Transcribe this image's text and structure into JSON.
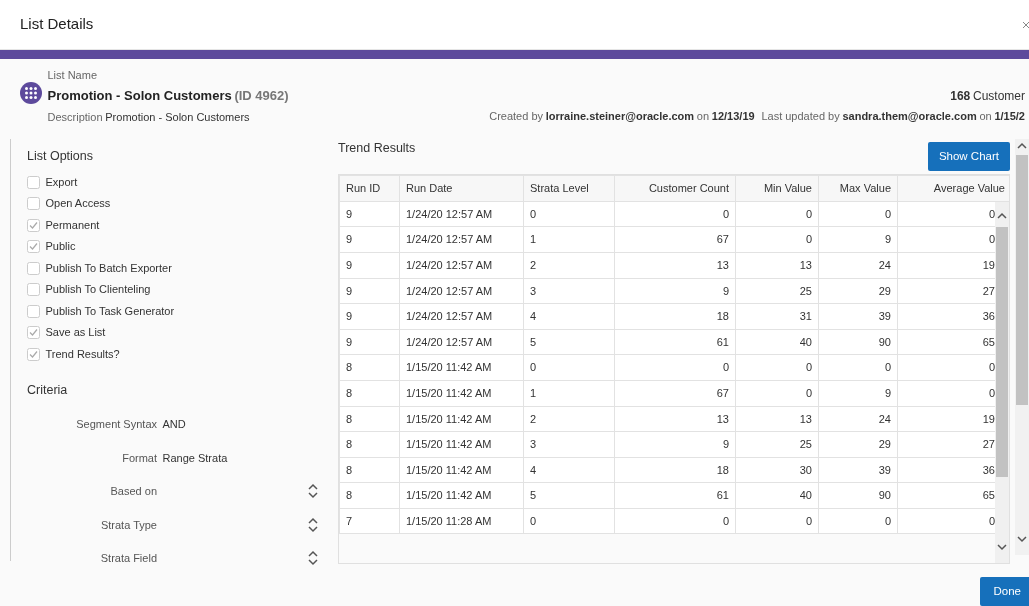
{
  "dialog": {
    "title": "List Details"
  },
  "list": {
    "name_label": "List Name",
    "name": "Promotion - Solon Customers",
    "id": "(ID 4962)",
    "description_label": "Description",
    "description": "Promotion - Solon Customers",
    "count": "168",
    "count_label": "Customer",
    "created_label": "Created by",
    "created_by": "lorraine.steiner@oracle.com",
    "created_on_label": "on",
    "created_on": "12/13/19",
    "updated_label": "Last updated by",
    "updated_by": "sandra.them@oracle.com",
    "updated_on_label": "on",
    "updated_on": "1/15/2"
  },
  "list_options": {
    "title": "List Options",
    "items": [
      {
        "label": "Export",
        "checked": false
      },
      {
        "label": "Open Access",
        "checked": false
      },
      {
        "label": "Permanent",
        "checked": true
      },
      {
        "label": "Public",
        "checked": true
      },
      {
        "label": "Publish To Batch Exporter",
        "checked": false
      },
      {
        "label": "Publish To Clienteling",
        "checked": false
      },
      {
        "label": "Publish To Task Generator",
        "checked": false
      },
      {
        "label": "Save as List",
        "checked": true
      },
      {
        "label": "Trend Results?",
        "checked": true
      }
    ]
  },
  "criteria": {
    "title": "Criteria",
    "fields": [
      {
        "kind": "text",
        "label": "Segment Syntax",
        "value": "AND"
      },
      {
        "kind": "text",
        "label": "Format",
        "value": "Range Strata"
      },
      {
        "kind": "select",
        "label": "Based on"
      },
      {
        "kind": "select",
        "label": "Strata Type"
      },
      {
        "kind": "select",
        "label": "Strata Field"
      }
    ]
  },
  "trend_results": {
    "title": "Trend Results",
    "button": "Show Chart",
    "columns": [
      "Run ID",
      "Run Date",
      "Strata Level",
      "Customer Count",
      "Min Value",
      "Max Value",
      "Average Value"
    ],
    "rows": [
      [
        "9",
        "1/24/20 12:57 AM",
        "0",
        "0",
        "0",
        "0",
        "0"
      ],
      [
        "9",
        "1/24/20 12:57 AM",
        "1",
        "67",
        "0",
        "9",
        "0"
      ],
      [
        "9",
        "1/24/20 12:57 AM",
        "2",
        "13",
        "13",
        "24",
        "19"
      ],
      [
        "9",
        "1/24/20 12:57 AM",
        "3",
        "9",
        "25",
        "29",
        "27"
      ],
      [
        "9",
        "1/24/20 12:57 AM",
        "4",
        "18",
        "31",
        "39",
        "36"
      ],
      [
        "9",
        "1/24/20 12:57 AM",
        "5",
        "61",
        "40",
        "90",
        "65"
      ],
      [
        "8",
        "1/15/20 11:42 AM",
        "0",
        "0",
        "0",
        "0",
        "0"
      ],
      [
        "8",
        "1/15/20 11:42 AM",
        "1",
        "67",
        "0",
        "9",
        "0"
      ],
      [
        "8",
        "1/15/20 11:42 AM",
        "2",
        "13",
        "13",
        "24",
        "19"
      ],
      [
        "8",
        "1/15/20 11:42 AM",
        "3",
        "9",
        "25",
        "29",
        "27"
      ],
      [
        "8",
        "1/15/20 11:42 AM",
        "4",
        "18",
        "30",
        "39",
        "36"
      ],
      [
        "8",
        "1/15/20 11:42 AM",
        "5",
        "61",
        "40",
        "90",
        "65"
      ],
      [
        "7",
        "1/15/20 11:28 AM",
        "0",
        "0",
        "0",
        "0",
        "0"
      ]
    ]
  },
  "footer": {
    "button": "Done"
  }
}
